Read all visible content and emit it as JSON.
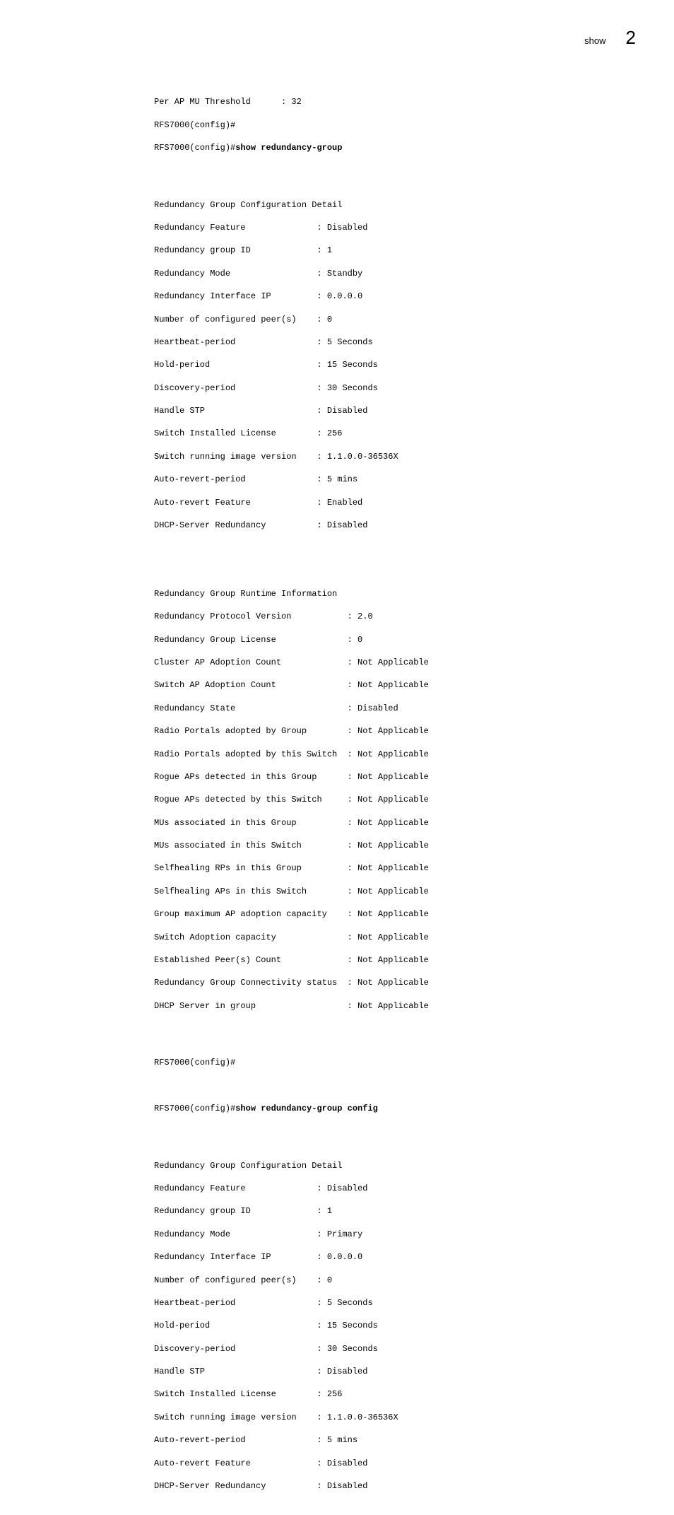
{
  "header": {
    "label": "show",
    "chapter": "2"
  },
  "intro": {
    "l1": "Per AP MU Threshold      : 32",
    "l2": "RFS7000(config)#",
    "l3p": "RFS7000(config)#",
    "l3b": "show redundancy-group"
  },
  "sec1": {
    "title": "Redundancy Group Configuration Detail",
    "rows": [
      {
        "k": "Redundancy Feature              ",
        "v": ": Disabled"
      },
      {
        "k": "Redundancy group ID             ",
        "v": ": 1"
      },
      {
        "k": "Redundancy Mode                 ",
        "v": ": Standby"
      },
      {
        "k": "Redundancy Interface IP         ",
        "v": ": 0.0.0.0"
      },
      {
        "k": "Number of configured peer(s)    ",
        "v": ": 0"
      },
      {
        "k": "Heartbeat-period                ",
        "v": ": 5 Seconds"
      },
      {
        "k": "Hold-period                     ",
        "v": ": 15 Seconds"
      },
      {
        "k": "Discovery-period                ",
        "v": ": 30 Seconds"
      },
      {
        "k": "Handle STP                      ",
        "v": ": Disabled"
      },
      {
        "k": "Switch Installed License        ",
        "v": ": 256"
      },
      {
        "k": "Switch running image version    ",
        "v": ": 1.1.0.0-36536X"
      },
      {
        "k": "Auto-revert-period              ",
        "v": ": 5 mins"
      },
      {
        "k": "Auto-revert Feature             ",
        "v": ": Enabled"
      },
      {
        "k": "DHCP-Server Redundancy          ",
        "v": ": Disabled"
      }
    ]
  },
  "sec2": {
    "title": "Redundancy Group Runtime Information",
    "rows": [
      {
        "k": "Redundancy Protocol Version           ",
        "v": ": 2.0"
      },
      {
        "k": "Redundancy Group License              ",
        "v": ": 0"
      },
      {
        "k": "Cluster AP Adoption Count             ",
        "v": ": Not Applicable"
      },
      {
        "k": "Switch AP Adoption Count              ",
        "v": ": Not Applicable"
      },
      {
        "k": "Redundancy State                      ",
        "v": ": Disabled"
      },
      {
        "k": "Radio Portals adopted by Group        ",
        "v": ": Not Applicable"
      },
      {
        "k": "Radio Portals adopted by this Switch  ",
        "v": ": Not Applicable"
      },
      {
        "k": "Rogue APs detected in this Group      ",
        "v": ": Not Applicable"
      },
      {
        "k": "Rogue APs detected by this Switch     ",
        "v": ": Not Applicable"
      },
      {
        "k": "MUs associated in this Group          ",
        "v": ": Not Applicable"
      },
      {
        "k": "MUs associated in this Switch         ",
        "v": ": Not Applicable"
      },
      {
        "k": "Selfhealing RPs in this Group         ",
        "v": ": Not Applicable"
      },
      {
        "k": "Selfhealing APs in this Switch        ",
        "v": ": Not Applicable"
      },
      {
        "k": "Group maximum AP adoption capacity    ",
        "v": ": Not Applicable"
      },
      {
        "k": "Switch Adoption capacity              ",
        "v": ": Not Applicable"
      },
      {
        "k": "Established Peer(s) Count             ",
        "v": ": Not Applicable"
      },
      {
        "k": "Redundancy Group Connectivity status  ",
        "v": ": Not Applicable"
      },
      {
        "k": "DHCP Server in group                  ",
        "v": ": Not Applicable"
      }
    ]
  },
  "mid": {
    "l1": "RFS7000(config)#",
    "l2p": "RFS7000(config)#",
    "l2b": "show redundancy-group config"
  },
  "sec3": {
    "title": "Redundancy Group Configuration Detail",
    "rows": [
      {
        "k": "Redundancy Feature              ",
        "v": ": Disabled"
      },
      {
        "k": "Redundancy group ID             ",
        "v": ": 1"
      },
      {
        "k": "Redundancy Mode                 ",
        "v": ": Primary"
      },
      {
        "k": "Redundancy Interface IP         ",
        "v": ": 0.0.0.0"
      },
      {
        "k": "Number of configured peer(s)    ",
        "v": ": 0"
      },
      {
        "k": "Heartbeat-period                ",
        "v": ": 5 Seconds"
      },
      {
        "k": "Hold-period                     ",
        "v": ": 15 Seconds"
      },
      {
        "k": "Discovery-period                ",
        "v": ": 30 Seconds"
      },
      {
        "k": "Handle STP                      ",
        "v": ": Disabled"
      },
      {
        "k": "Switch Installed License        ",
        "v": ": 256"
      },
      {
        "k": "Switch running image version    ",
        "v": ": 1.1.0.0-36536X"
      },
      {
        "k": "Auto-revert-period              ",
        "v": ": 5 mins"
      },
      {
        "k": "Auto-revert Feature             ",
        "v": ": Disabled"
      },
      {
        "k": "DHCP-Server Redundancy          ",
        "v": ": Disabled"
      }
    ]
  }
}
